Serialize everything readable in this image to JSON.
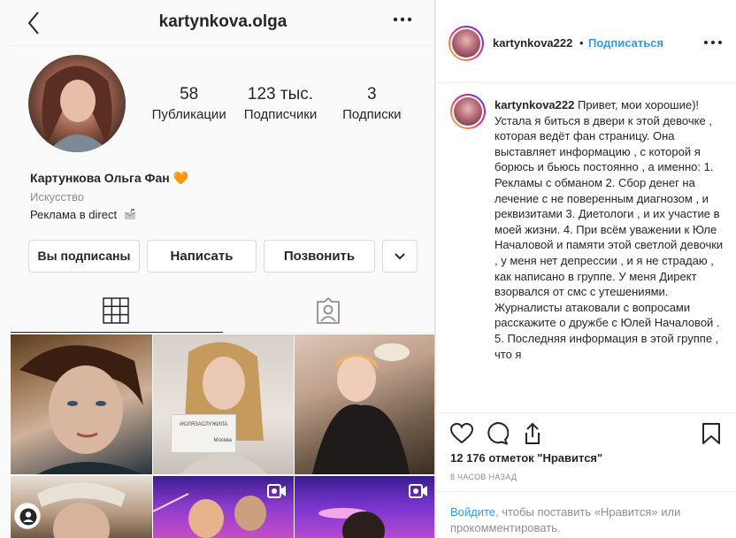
{
  "profile": {
    "username": "kartynkova.olga",
    "stats": [
      {
        "value": "58",
        "label": "Публикации"
      },
      {
        "value": "123 тыс.",
        "label": "Подписчики"
      },
      {
        "value": "3",
        "label": "Подписки"
      }
    ],
    "full_name": "Картункова Ольга Фан",
    "name_emoji": "🧡",
    "category": "Искусство",
    "bio": "Реклама в direct",
    "buttons": {
      "subscribed": "Вы подписаны",
      "message": "Написать",
      "call": "Позвонить"
    },
    "post_sign_text": "#ЮЛЯЗАСЛУЖИЛА",
    "post_sign_caption": "Москва"
  },
  "post": {
    "author": "kartynkova222",
    "separator": "•",
    "follow_label": "Подписаться",
    "caption_author": "kartynkova222",
    "caption": "Привет, мои хорошие)! Устала я биться в двери к этой девочке , которая ведёт фан страницу. Она выставляет информацию , с которой я борюсь и бьюсь постоянно , а именно: 1. Рекламы с обманом 2. Сбор денег на лечение с не поверенным диагнозом , и реквизитами 3. Диетологи , и их участие в моей жизни. 4. При всём уважении к Юле Началовой и памяти этой светлой девочки , у меня нет депрессии , и я не страдаю , как написано в группе. У меня Директ взорвался от смс с утешениями. Журналисты атаковали с вопросами расскажите о дружбе с Юлей Началовой . 5. Последняя информация в этой группе , что я",
    "likes": "12 176 отметок \"Нравится\"",
    "time": "8 ЧАСОВ НАЗАД",
    "comment_login": "Войдите",
    "comment_rest": ", чтобы поставить «Нравится» или прокомментировать."
  },
  "colors": {
    "link_blue": "#3897f0",
    "border": "#dbdbdb",
    "text": "#262626",
    "muted": "#8e8e8e"
  }
}
